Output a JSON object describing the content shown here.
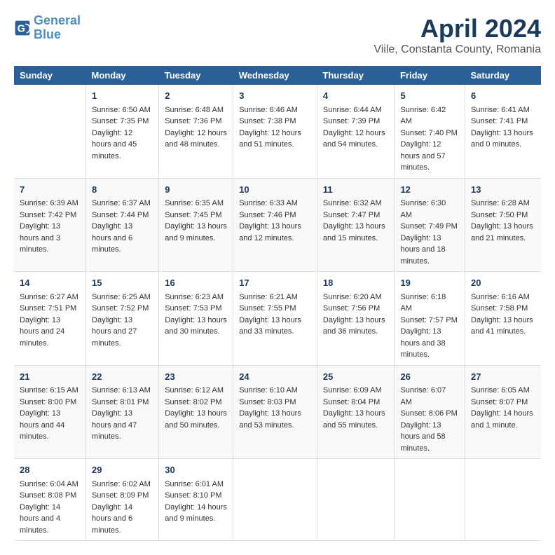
{
  "header": {
    "logo_line1": "General",
    "logo_line2": "Blue",
    "title": "April 2024",
    "subtitle": "Viile, Constanta County, Romania"
  },
  "calendar": {
    "days_of_week": [
      "Sunday",
      "Monday",
      "Tuesday",
      "Wednesday",
      "Thursday",
      "Friday",
      "Saturday"
    ],
    "weeks": [
      [
        {
          "day": "",
          "sunrise": "",
          "sunset": "",
          "daylight": ""
        },
        {
          "day": "1",
          "sunrise": "Sunrise: 6:50 AM",
          "sunset": "Sunset: 7:35 PM",
          "daylight": "Daylight: 12 hours and 45 minutes."
        },
        {
          "day": "2",
          "sunrise": "Sunrise: 6:48 AM",
          "sunset": "Sunset: 7:36 PM",
          "daylight": "Daylight: 12 hours and 48 minutes."
        },
        {
          "day": "3",
          "sunrise": "Sunrise: 6:46 AM",
          "sunset": "Sunset: 7:38 PM",
          "daylight": "Daylight: 12 hours and 51 minutes."
        },
        {
          "day": "4",
          "sunrise": "Sunrise: 6:44 AM",
          "sunset": "Sunset: 7:39 PM",
          "daylight": "Daylight: 12 hours and 54 minutes."
        },
        {
          "day": "5",
          "sunrise": "Sunrise: 6:42 AM",
          "sunset": "Sunset: 7:40 PM",
          "daylight": "Daylight: 12 hours and 57 minutes."
        },
        {
          "day": "6",
          "sunrise": "Sunrise: 6:41 AM",
          "sunset": "Sunset: 7:41 PM",
          "daylight": "Daylight: 13 hours and 0 minutes."
        }
      ],
      [
        {
          "day": "7",
          "sunrise": "Sunrise: 6:39 AM",
          "sunset": "Sunset: 7:42 PM",
          "daylight": "Daylight: 13 hours and 3 minutes."
        },
        {
          "day": "8",
          "sunrise": "Sunrise: 6:37 AM",
          "sunset": "Sunset: 7:44 PM",
          "daylight": "Daylight: 13 hours and 6 minutes."
        },
        {
          "day": "9",
          "sunrise": "Sunrise: 6:35 AM",
          "sunset": "Sunset: 7:45 PM",
          "daylight": "Daylight: 13 hours and 9 minutes."
        },
        {
          "day": "10",
          "sunrise": "Sunrise: 6:33 AM",
          "sunset": "Sunset: 7:46 PM",
          "daylight": "Daylight: 13 hours and 12 minutes."
        },
        {
          "day": "11",
          "sunrise": "Sunrise: 6:32 AM",
          "sunset": "Sunset: 7:47 PM",
          "daylight": "Daylight: 13 hours and 15 minutes."
        },
        {
          "day": "12",
          "sunrise": "Sunrise: 6:30 AM",
          "sunset": "Sunset: 7:49 PM",
          "daylight": "Daylight: 13 hours and 18 minutes."
        },
        {
          "day": "13",
          "sunrise": "Sunrise: 6:28 AM",
          "sunset": "Sunset: 7:50 PM",
          "daylight": "Daylight: 13 hours and 21 minutes."
        }
      ],
      [
        {
          "day": "14",
          "sunrise": "Sunrise: 6:27 AM",
          "sunset": "Sunset: 7:51 PM",
          "daylight": "Daylight: 13 hours and 24 minutes."
        },
        {
          "day": "15",
          "sunrise": "Sunrise: 6:25 AM",
          "sunset": "Sunset: 7:52 PM",
          "daylight": "Daylight: 13 hours and 27 minutes."
        },
        {
          "day": "16",
          "sunrise": "Sunrise: 6:23 AM",
          "sunset": "Sunset: 7:53 PM",
          "daylight": "Daylight: 13 hours and 30 minutes."
        },
        {
          "day": "17",
          "sunrise": "Sunrise: 6:21 AM",
          "sunset": "Sunset: 7:55 PM",
          "daylight": "Daylight: 13 hours and 33 minutes."
        },
        {
          "day": "18",
          "sunrise": "Sunrise: 6:20 AM",
          "sunset": "Sunset: 7:56 PM",
          "daylight": "Daylight: 13 hours and 36 minutes."
        },
        {
          "day": "19",
          "sunrise": "Sunrise: 6:18 AM",
          "sunset": "Sunset: 7:57 PM",
          "daylight": "Daylight: 13 hours and 38 minutes."
        },
        {
          "day": "20",
          "sunrise": "Sunrise: 6:16 AM",
          "sunset": "Sunset: 7:58 PM",
          "daylight": "Daylight: 13 hours and 41 minutes."
        }
      ],
      [
        {
          "day": "21",
          "sunrise": "Sunrise: 6:15 AM",
          "sunset": "Sunset: 8:00 PM",
          "daylight": "Daylight: 13 hours and 44 minutes."
        },
        {
          "day": "22",
          "sunrise": "Sunrise: 6:13 AM",
          "sunset": "Sunset: 8:01 PM",
          "daylight": "Daylight: 13 hours and 47 minutes."
        },
        {
          "day": "23",
          "sunrise": "Sunrise: 6:12 AM",
          "sunset": "Sunset: 8:02 PM",
          "daylight": "Daylight: 13 hours and 50 minutes."
        },
        {
          "day": "24",
          "sunrise": "Sunrise: 6:10 AM",
          "sunset": "Sunset: 8:03 PM",
          "daylight": "Daylight: 13 hours and 53 minutes."
        },
        {
          "day": "25",
          "sunrise": "Sunrise: 6:09 AM",
          "sunset": "Sunset: 8:04 PM",
          "daylight": "Daylight: 13 hours and 55 minutes."
        },
        {
          "day": "26",
          "sunrise": "Sunrise: 6:07 AM",
          "sunset": "Sunset: 8:06 PM",
          "daylight": "Daylight: 13 hours and 58 minutes."
        },
        {
          "day": "27",
          "sunrise": "Sunrise: 6:05 AM",
          "sunset": "Sunset: 8:07 PM",
          "daylight": "Daylight: 14 hours and 1 minute."
        }
      ],
      [
        {
          "day": "28",
          "sunrise": "Sunrise: 6:04 AM",
          "sunset": "Sunset: 8:08 PM",
          "daylight": "Daylight: 14 hours and 4 minutes."
        },
        {
          "day": "29",
          "sunrise": "Sunrise: 6:02 AM",
          "sunset": "Sunset: 8:09 PM",
          "daylight": "Daylight: 14 hours and 6 minutes."
        },
        {
          "day": "30",
          "sunrise": "Sunrise: 6:01 AM",
          "sunset": "Sunset: 8:10 PM",
          "daylight": "Daylight: 14 hours and 9 minutes."
        },
        {
          "day": "",
          "sunrise": "",
          "sunset": "",
          "daylight": ""
        },
        {
          "day": "",
          "sunrise": "",
          "sunset": "",
          "daylight": ""
        },
        {
          "day": "",
          "sunrise": "",
          "sunset": "",
          "daylight": ""
        },
        {
          "day": "",
          "sunrise": "",
          "sunset": "",
          "daylight": ""
        }
      ]
    ]
  }
}
